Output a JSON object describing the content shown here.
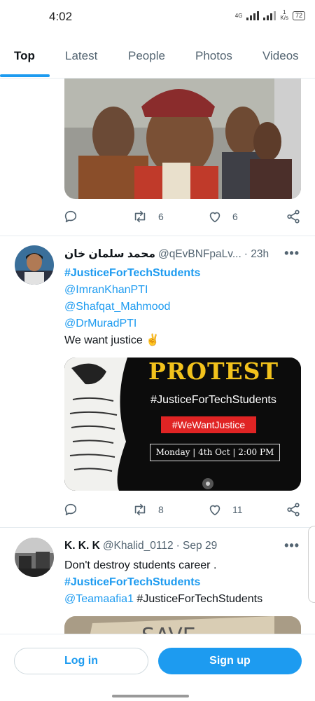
{
  "status_bar": {
    "time": "4:02",
    "network": "4G",
    "speed_value": "1",
    "speed_unit": "K/s",
    "battery": "72"
  },
  "tabs": [
    {
      "label": "Top",
      "active": true
    },
    {
      "label": "Latest"
    },
    {
      "label": "People"
    },
    {
      "label": "Photos"
    },
    {
      "label": "Videos"
    }
  ],
  "tweet0": {
    "retweets": "6",
    "likes": "6"
  },
  "tweet1": {
    "name": "محمد سلمان خان",
    "handle": "@qEvBNFpaLv...",
    "time": "· 23h",
    "lines": [
      "#JusticeForTechStudents",
      "@ImranKhanPTI",
      "@Shafqat_Mahmood",
      "@DrMuradPTI",
      "We want justice ✌️"
    ],
    "image": {
      "heading": "PROTEST",
      "hashtag": "#JusticeForTechStudents",
      "badge": "#WeWantJustice",
      "date": "Monday | 4th Oct | 2:00 PM"
    },
    "retweets": "8",
    "likes": "11"
  },
  "tweet2": {
    "name": "K. K. K",
    "handle": "@Khalid_0112",
    "time": "· Sep 29",
    "line1": "Don't destroy students career .",
    "line2": "#JusticeForTechStudents",
    "line3_mention": "@Teamaafia1",
    "line3_tag": " #JusticeForTechStudents"
  },
  "bottom": {
    "login": "Log in",
    "signup": "Sign up"
  },
  "colors": {
    "accent": "#1d9bf0",
    "text": "#0f1419",
    "muted": "#536471"
  }
}
